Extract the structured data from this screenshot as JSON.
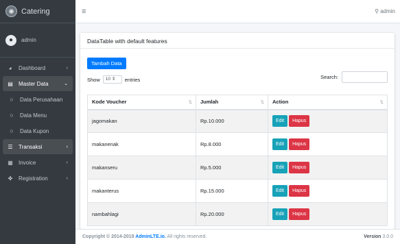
{
  "brand": {
    "name": "Catering",
    "logo_icon": "catering-logo"
  },
  "user": {
    "name": "admin",
    "top_name": "admin"
  },
  "sidebar": {
    "items": [
      {
        "label": "Dashboard",
        "icon": "tachometer-icon",
        "chevron": "‹"
      },
      {
        "label": "Master Data",
        "icon": "database-icon",
        "chevron": "⌄"
      },
      {
        "label": "Data Perusahaan",
        "icon": "circle-icon"
      },
      {
        "label": "Data Menu",
        "icon": "circle-icon"
      },
      {
        "label": "Data Kupon",
        "icon": "circle-icon"
      },
      {
        "label": "Transaksi",
        "icon": "list-icon",
        "chevron": "‹"
      },
      {
        "label": "Invoice",
        "icon": "table-icon",
        "chevron": "‹"
      },
      {
        "label": "Registration",
        "icon": "users-icon",
        "chevron": "‹"
      }
    ]
  },
  "card": {
    "title": "DataTable with default features"
  },
  "toolbar": {
    "add_label": "Tambah Data"
  },
  "table_controls": {
    "show_label": "Show",
    "entries_value": "10",
    "entries_label": "entries",
    "search_label": "Search:"
  },
  "table": {
    "headers": [
      "Kode Voucher",
      "Jumlah",
      "Action"
    ],
    "rows": [
      {
        "kode": "jagomakan",
        "jumlah": "Rp.10.000"
      },
      {
        "kode": "makanenak",
        "jumlah": "Rp.8.000"
      },
      {
        "kode": "makanseru",
        "jumlah": "Rp.5.000"
      },
      {
        "kode": "makanterus",
        "jumlah": "Rp.15.000"
      },
      {
        "kode": "nambahlagi",
        "jumlah": "Rp.20.000"
      }
    ],
    "edit_label": "Edit",
    "delete_label": "Hapus"
  },
  "footer": {
    "copyright_prefix": "Copyright © 2014-2019 ",
    "brand_link": "AdminLTE.io.",
    "rights": " All rights reserved.",
    "version_label": "Version",
    "version_value": "3.0.0"
  },
  "colors": {
    "sidebar_bg": "#343a40",
    "primary": "#007bff",
    "info": "#17a2b8",
    "danger": "#dc3545"
  }
}
